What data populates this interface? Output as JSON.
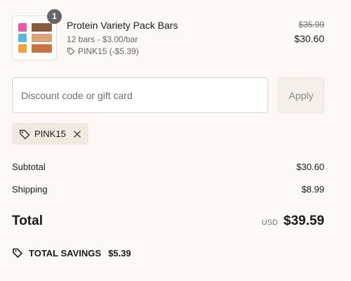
{
  "cart": {
    "item": {
      "quantity": "1",
      "name": "Protein Variety Pack Bars",
      "subtitle": "12 bars - $3.00/bar",
      "discount": "PINK15 (-$5.39)",
      "original_price": "$35.99",
      "price": "$30.60"
    }
  },
  "discount": {
    "placeholder": "Discount code or gift card",
    "apply_label": "Apply",
    "applied_code": "PINK15"
  },
  "summary": {
    "subtotal_label": "Subtotal",
    "subtotal_value": "$30.60",
    "shipping_label": "Shipping",
    "shipping_value": "$8.99",
    "total_label": "Total",
    "currency": "USD",
    "total_value": "$39.59",
    "savings_label": "TOTAL SAVINGS",
    "savings_value": "$5.39"
  },
  "icons": {
    "tag": "tag-icon",
    "close": "close-icon",
    "savings": "savings-tag-icon"
  }
}
